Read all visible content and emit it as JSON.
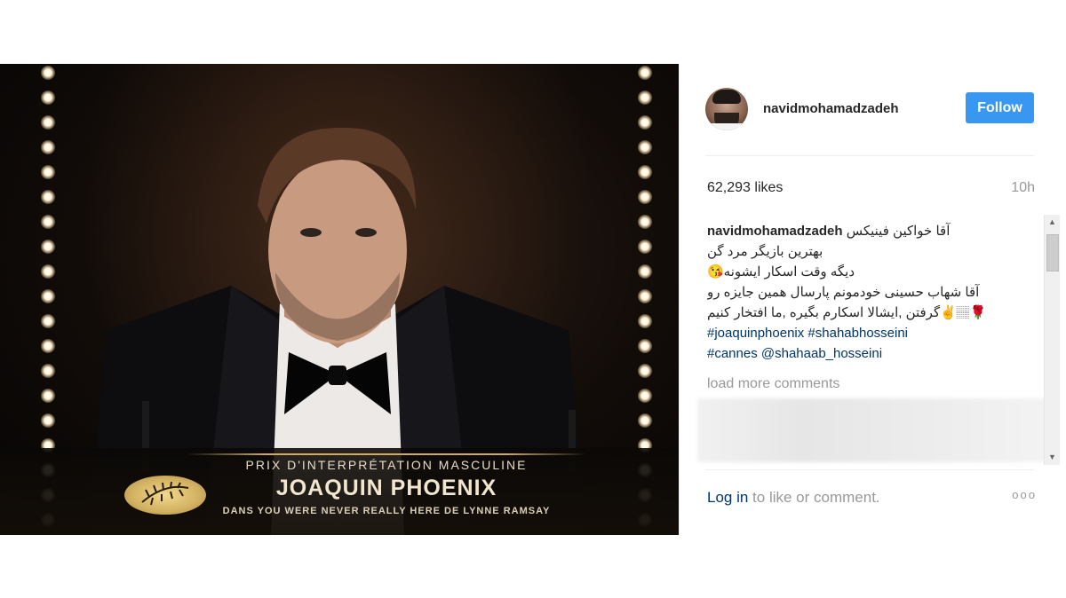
{
  "photo": {
    "award_title": "PRIX D'INTERPRÉTATION MASCULINE",
    "actor_name": "JOAQUIN PHOENIX",
    "film_line": "DANS YOU WERE NEVER REALLY HERE DE LYNNE RAMSAY",
    "badge_icon": "palme-d-or-icon"
  },
  "header": {
    "username": "navidmohamadzadeh",
    "follow_label": "Follow"
  },
  "stats": {
    "likes": "62,293 likes",
    "time": "10h"
  },
  "caption": {
    "username": "navidmohamadzadeh",
    "line1": "آقا خواکین فینیکس",
    "line2": "بهترین بازیگر مرد گن",
    "line3": "دیگه وقت اسکار ایشونه😘",
    "line4": "آقا شهاب حسینی خودمونم پارسال همین جایزه رو",
    "line5": "🌹🏽✌گرفتن ,ایشالا اسکارم بگیره ,ما افتخار کنیم",
    "hashtags1": "#joaquinphoenix #shahabhosseini",
    "hashtags2": "#cannes @shahaab_hosseini"
  },
  "comments": {
    "load_more": "load more comments"
  },
  "footer": {
    "login_link": "Log in",
    "login_text": " to like or comment.",
    "more": "ooo"
  },
  "colors": {
    "follow_button": "#3897f0",
    "link": "#003569",
    "muted": "#999999"
  }
}
